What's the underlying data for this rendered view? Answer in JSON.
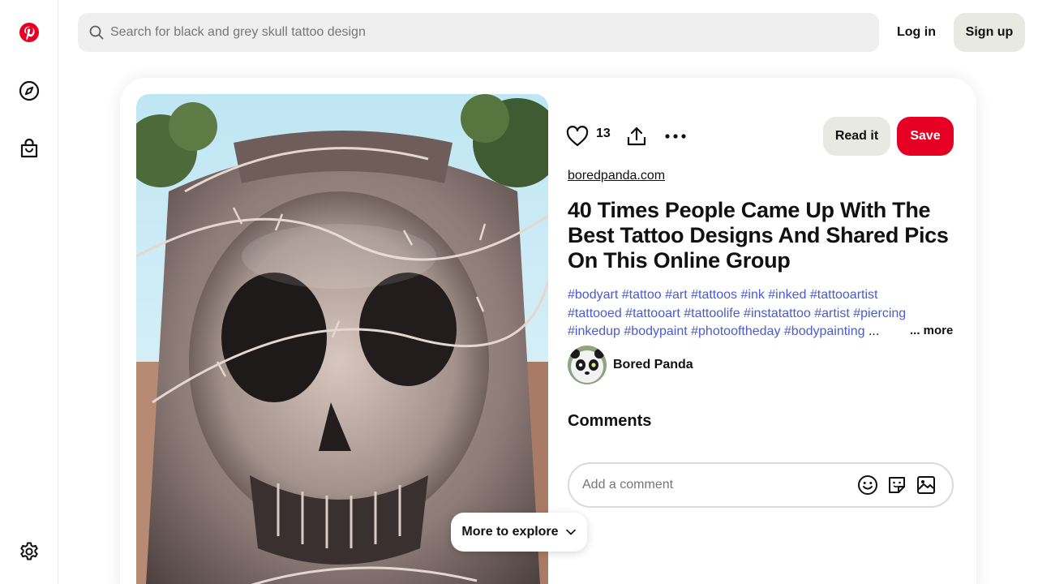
{
  "sidebar": {
    "items": [
      {
        "name": "pinterest-logo-icon"
      },
      {
        "name": "explore-compass-icon"
      },
      {
        "name": "shopping-bag-icon"
      },
      {
        "name": "settings-gear-icon"
      }
    ]
  },
  "topbar": {
    "search_placeholder": "Search for black and grey skull tattoo design",
    "login_label": "Log in",
    "signup_label": "Sign up"
  },
  "pin": {
    "reaction_count": "13",
    "read_label": "Read it",
    "save_label": "Save",
    "source": "boredpanda.com",
    "title": "40 Times People Came Up With The Best Tattoo Designs And Shared Pics On This Online Group",
    "hashtags": [
      "#bodyart",
      "#tattoo",
      "#art",
      "#tattoos",
      "#ink",
      "#inked",
      "#tattooartist",
      "#tattooed",
      "#tattooart",
      "#tattoolife",
      "#instatattoo",
      "#artist",
      "#piercing",
      "#inkedup",
      "#bodypaint",
      "#photooftheday",
      "#bodypainting"
    ],
    "hashtag_ellipsis": "...",
    "more_label": "... more",
    "author_name": "Bored Panda"
  },
  "comments": {
    "heading": "Comments",
    "placeholder": "Add a comment"
  },
  "explore": {
    "label": "More to explore"
  },
  "colors": {
    "brand_red": "#e60023",
    "hashtag_blue": "#4a5bd1",
    "secondary_button": "#e9e9e4",
    "search_bg": "#efefef"
  }
}
